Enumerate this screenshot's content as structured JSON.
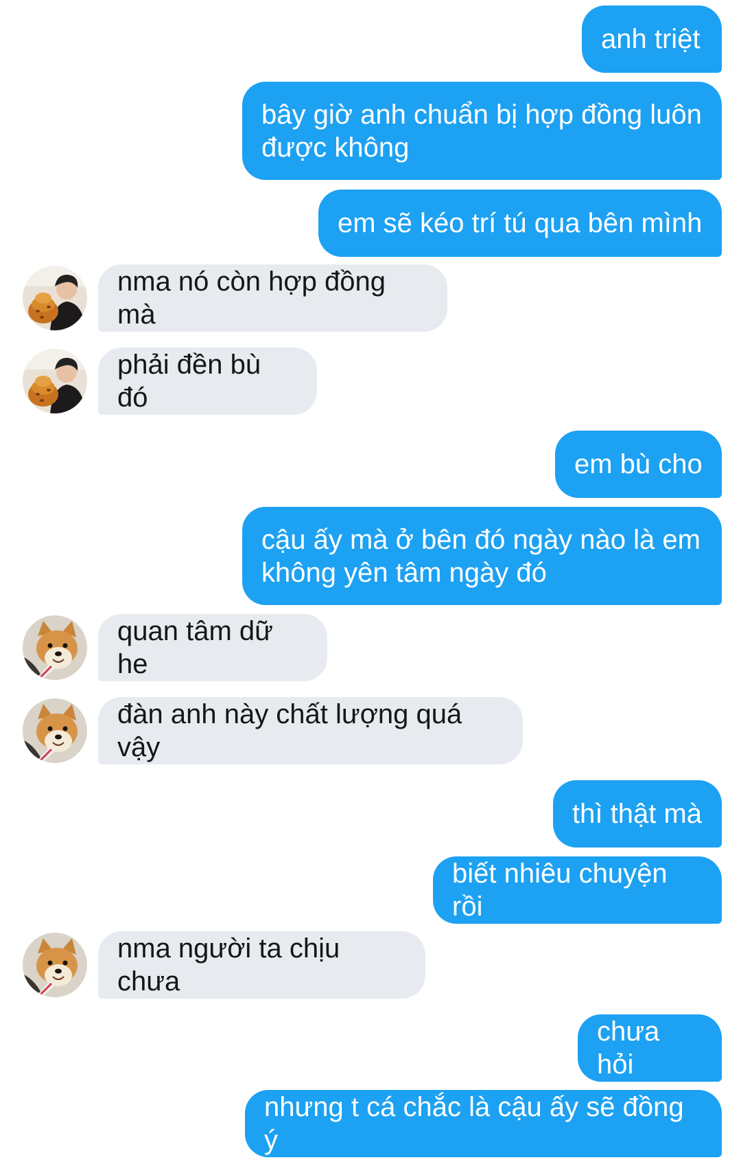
{
  "messages": [
    {
      "side": "out",
      "text": "anh triệt"
    },
    {
      "side": "out",
      "text": "bây giờ anh chuẩn bị hợp đồng luôn\nđược không"
    },
    {
      "side": "out",
      "text": "em sẽ kéo trí tú qua bên mình"
    },
    {
      "side": "in",
      "avatar": "man-with-food-avatar",
      "text": "nma nó còn hợp đồng mà"
    },
    {
      "side": "in",
      "avatar": "man-with-food-avatar",
      "text": "phải đền bù đó"
    },
    {
      "side": "out",
      "text": "em bù cho"
    },
    {
      "side": "out",
      "text": "cậu ấy mà ở bên đó ngày nào là em\nkhông yên tâm ngày đó"
    },
    {
      "side": "in",
      "avatar": "shiba-dog-avatar",
      "text": "quan tâm dữ he"
    },
    {
      "side": "in",
      "avatar": "shiba-dog-avatar",
      "text": "đàn anh này chất lượng quá vậy"
    },
    {
      "side": "out",
      "text": "thì thật mà"
    },
    {
      "side": "out",
      "text": "biết nhiêu chuyện rồi"
    },
    {
      "side": "in",
      "avatar": "shiba-dog-avatar",
      "text": "nma người ta chịu chưa"
    },
    {
      "side": "out",
      "text": "chưa hỏi"
    },
    {
      "side": "out",
      "text": "nhưng t cá chắc là cậu ấy sẽ đồng ý"
    }
  ],
  "colors": {
    "outgoing_bubble": "#1da1f2",
    "incoming_bubble": "#e7ebef",
    "outgoing_text": "#ffffff",
    "incoming_text": "#14171a"
  }
}
